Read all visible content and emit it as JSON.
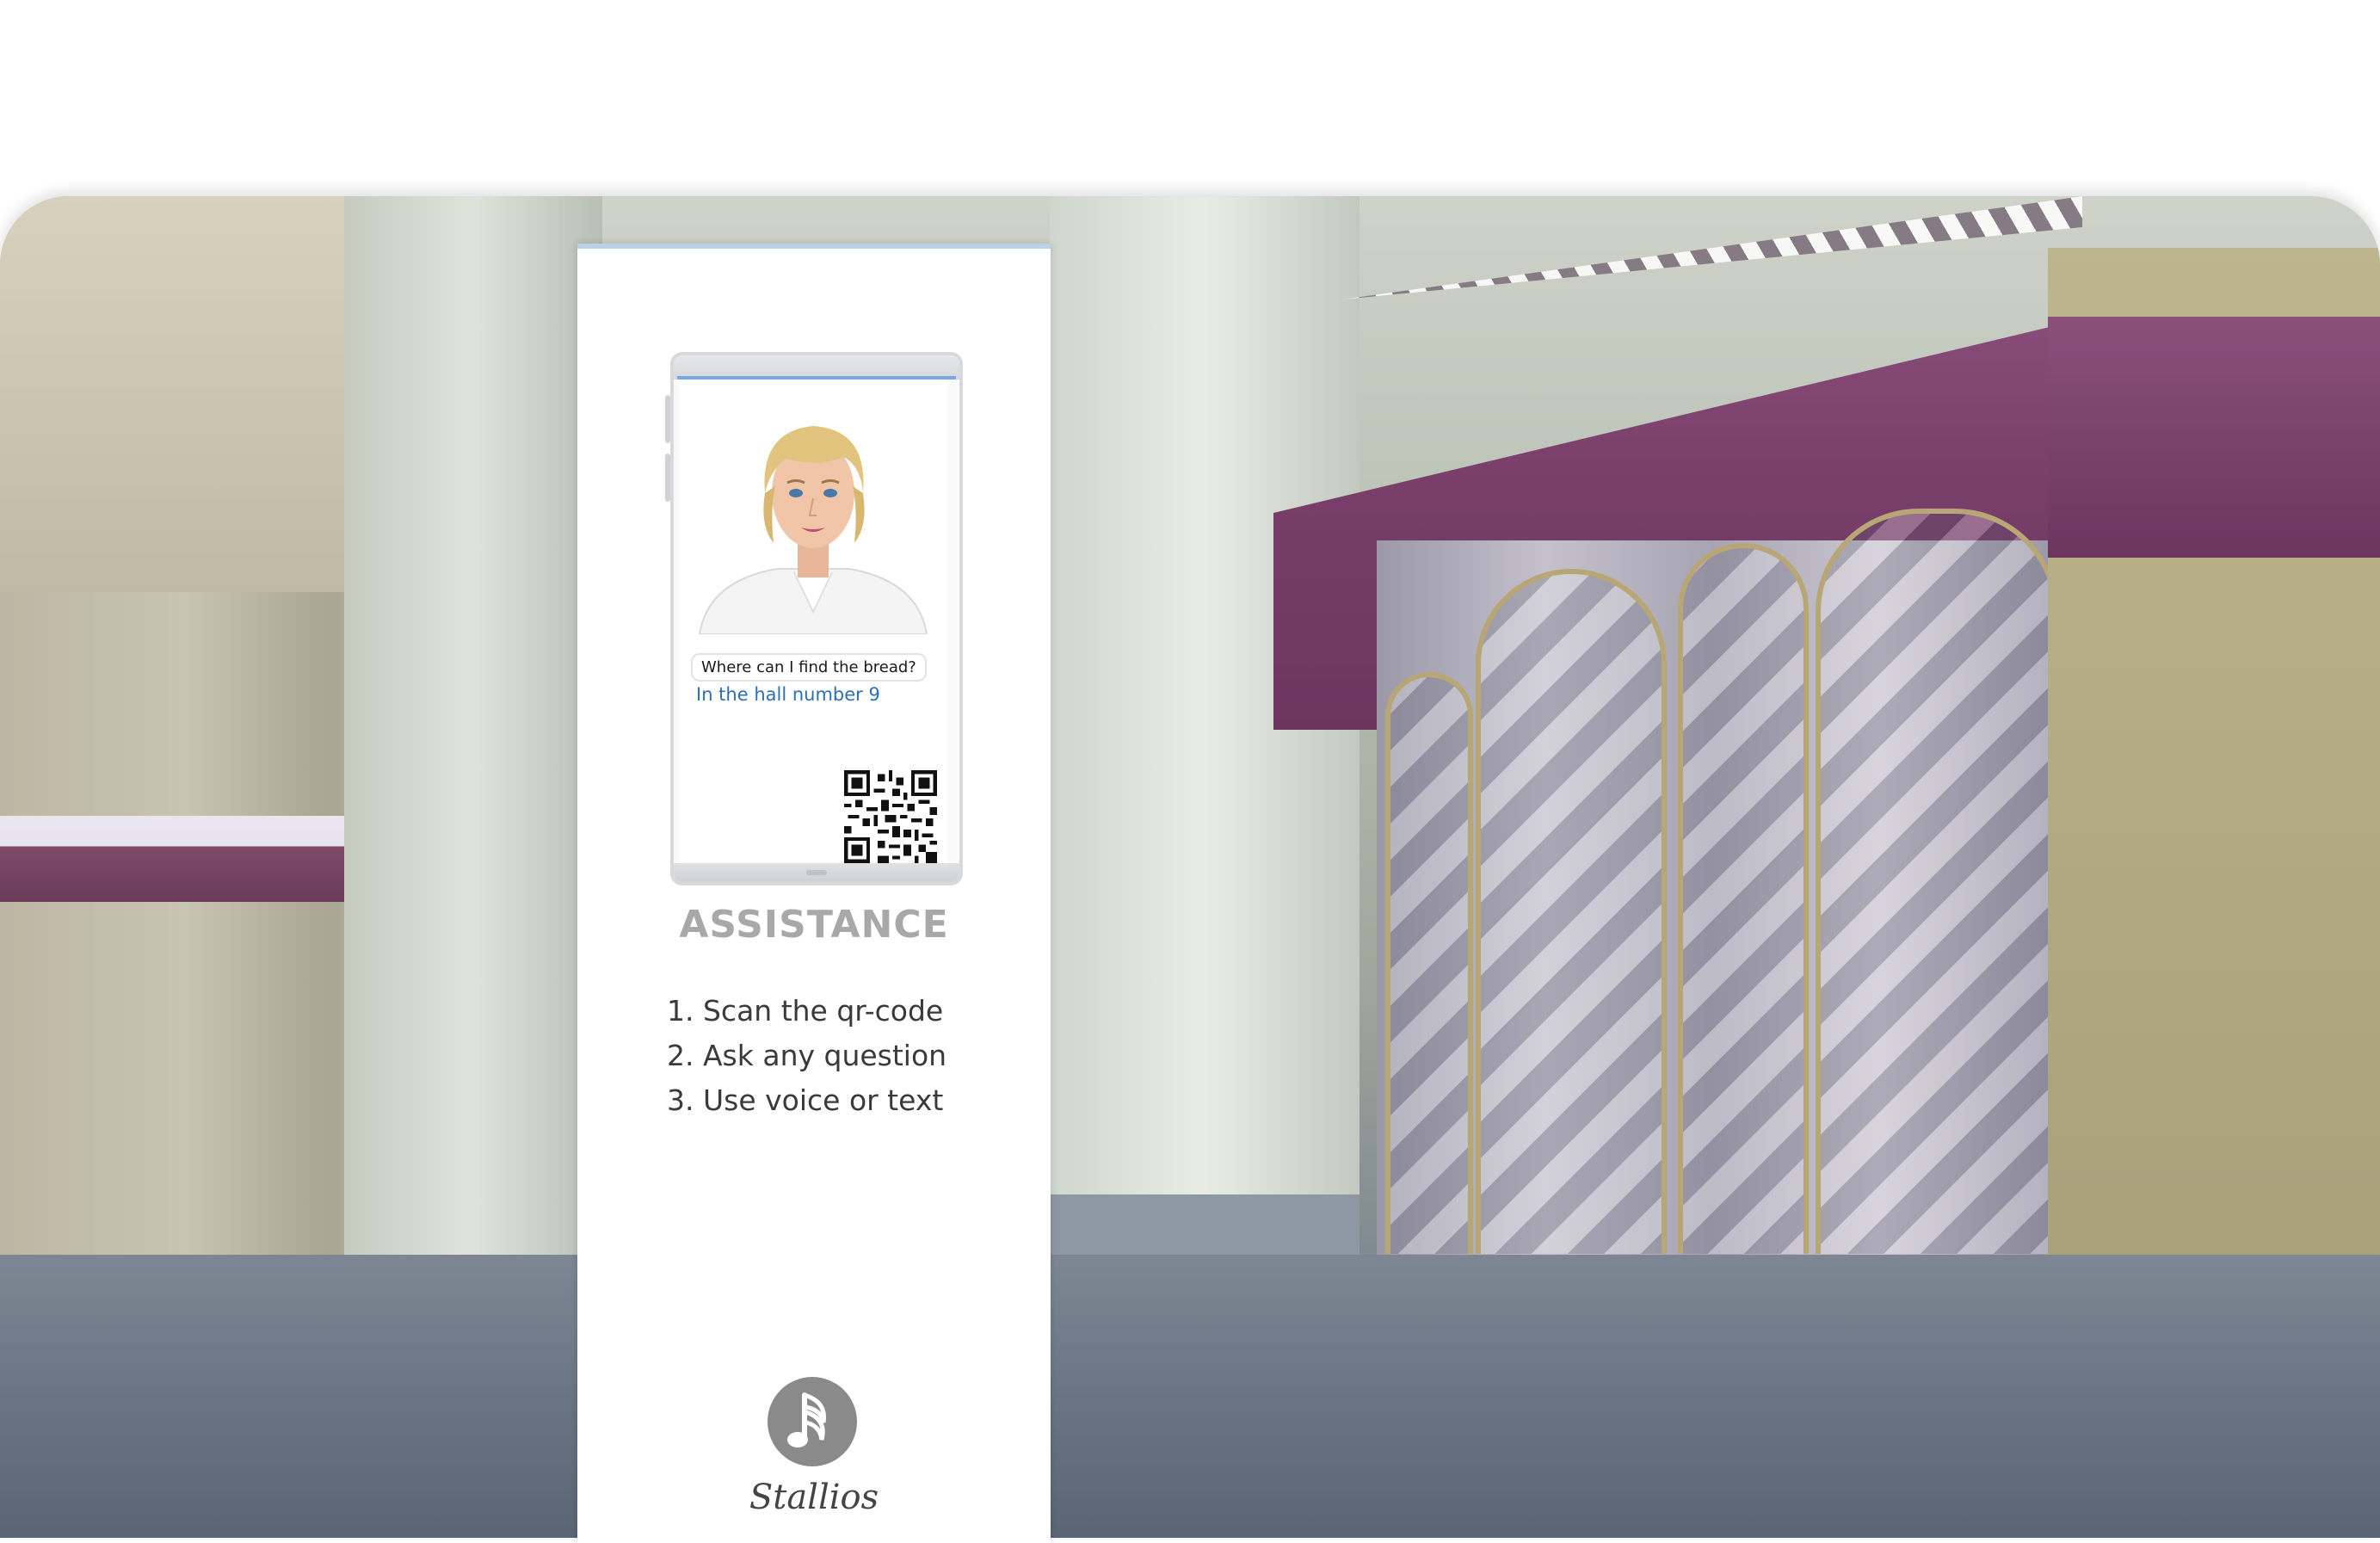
{
  "kiosk": {
    "chat": {
      "question": "Where can I find the bread?",
      "answer": "In the hall number 9"
    },
    "title": "ASSISTANCE",
    "steps": [
      "1. Scan the qr-code",
      "2. Ask any question",
      "3. Use voice or text"
    ],
    "brand_name": "Stallios",
    "accent_color": "#7aa7e6",
    "answer_color": "#2d6fb3"
  },
  "icons": {
    "qr": "qr-code-icon",
    "logo": "stallios-logo-icon"
  }
}
